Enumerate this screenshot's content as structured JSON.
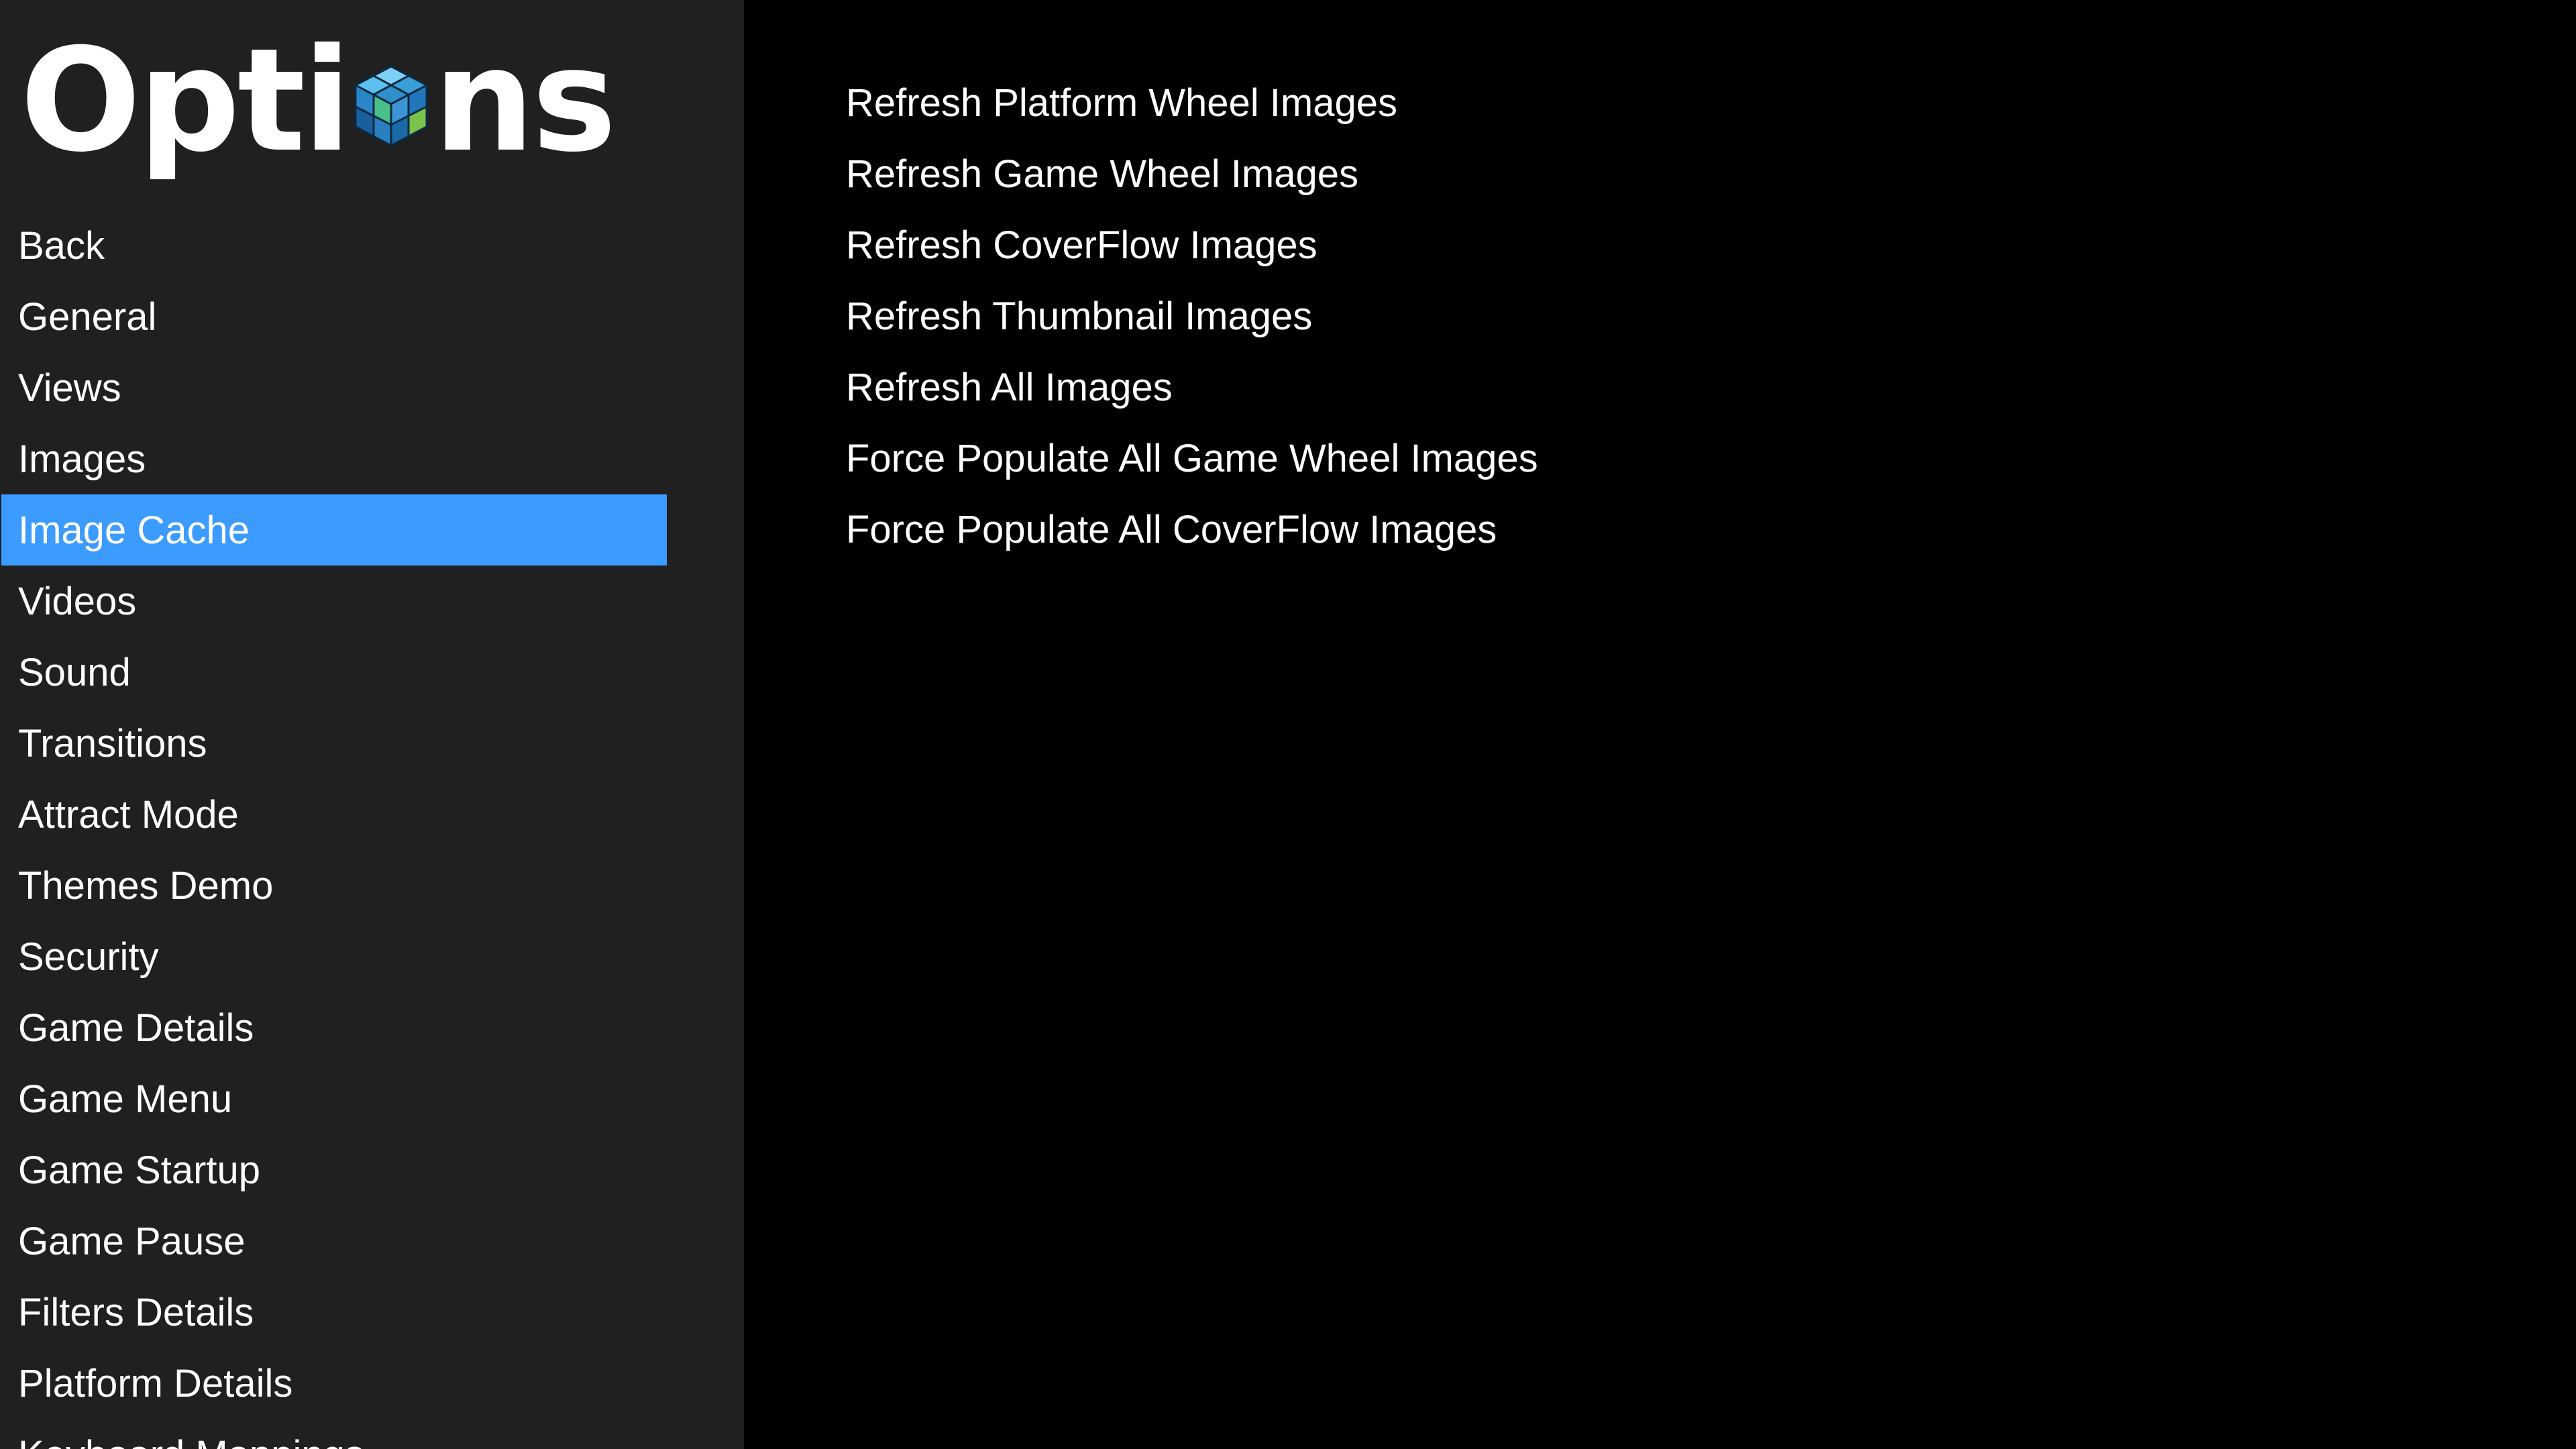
{
  "window": {
    "title": "Options"
  },
  "title": {
    "text_before": "Opti",
    "text_after": "ns",
    "icon": "cube-logo-icon"
  },
  "sidebar": {
    "selected_index": 4,
    "items": [
      {
        "label": "Back"
      },
      {
        "label": "General"
      },
      {
        "label": "Views"
      },
      {
        "label": "Images"
      },
      {
        "label": "Image Cache"
      },
      {
        "label": "Videos"
      },
      {
        "label": "Sound"
      },
      {
        "label": "Transitions"
      },
      {
        "label": "Attract Mode"
      },
      {
        "label": "Themes Demo"
      },
      {
        "label": "Security"
      },
      {
        "label": "Game Details"
      },
      {
        "label": "Game Menu"
      },
      {
        "label": "Game Startup"
      },
      {
        "label": "Game Pause"
      },
      {
        "label": "Filters Details"
      },
      {
        "label": "Platform Details"
      },
      {
        "label": "Keyboard Mappings"
      }
    ]
  },
  "main": {
    "actions": [
      {
        "label": "Refresh Platform Wheel Images"
      },
      {
        "label": "Refresh Game Wheel Images"
      },
      {
        "label": "Refresh CoverFlow Images"
      },
      {
        "label": "Refresh Thumbnail Images"
      },
      {
        "label": "Refresh All Images"
      },
      {
        "label": "Force Populate All Game Wheel Images"
      },
      {
        "label": "Force Populate All CoverFlow Images"
      }
    ]
  },
  "colors": {
    "sidebar_bg": "#202020",
    "content_bg": "#000000",
    "selected_bg": "#3b9bff",
    "text": "#ffffff"
  }
}
